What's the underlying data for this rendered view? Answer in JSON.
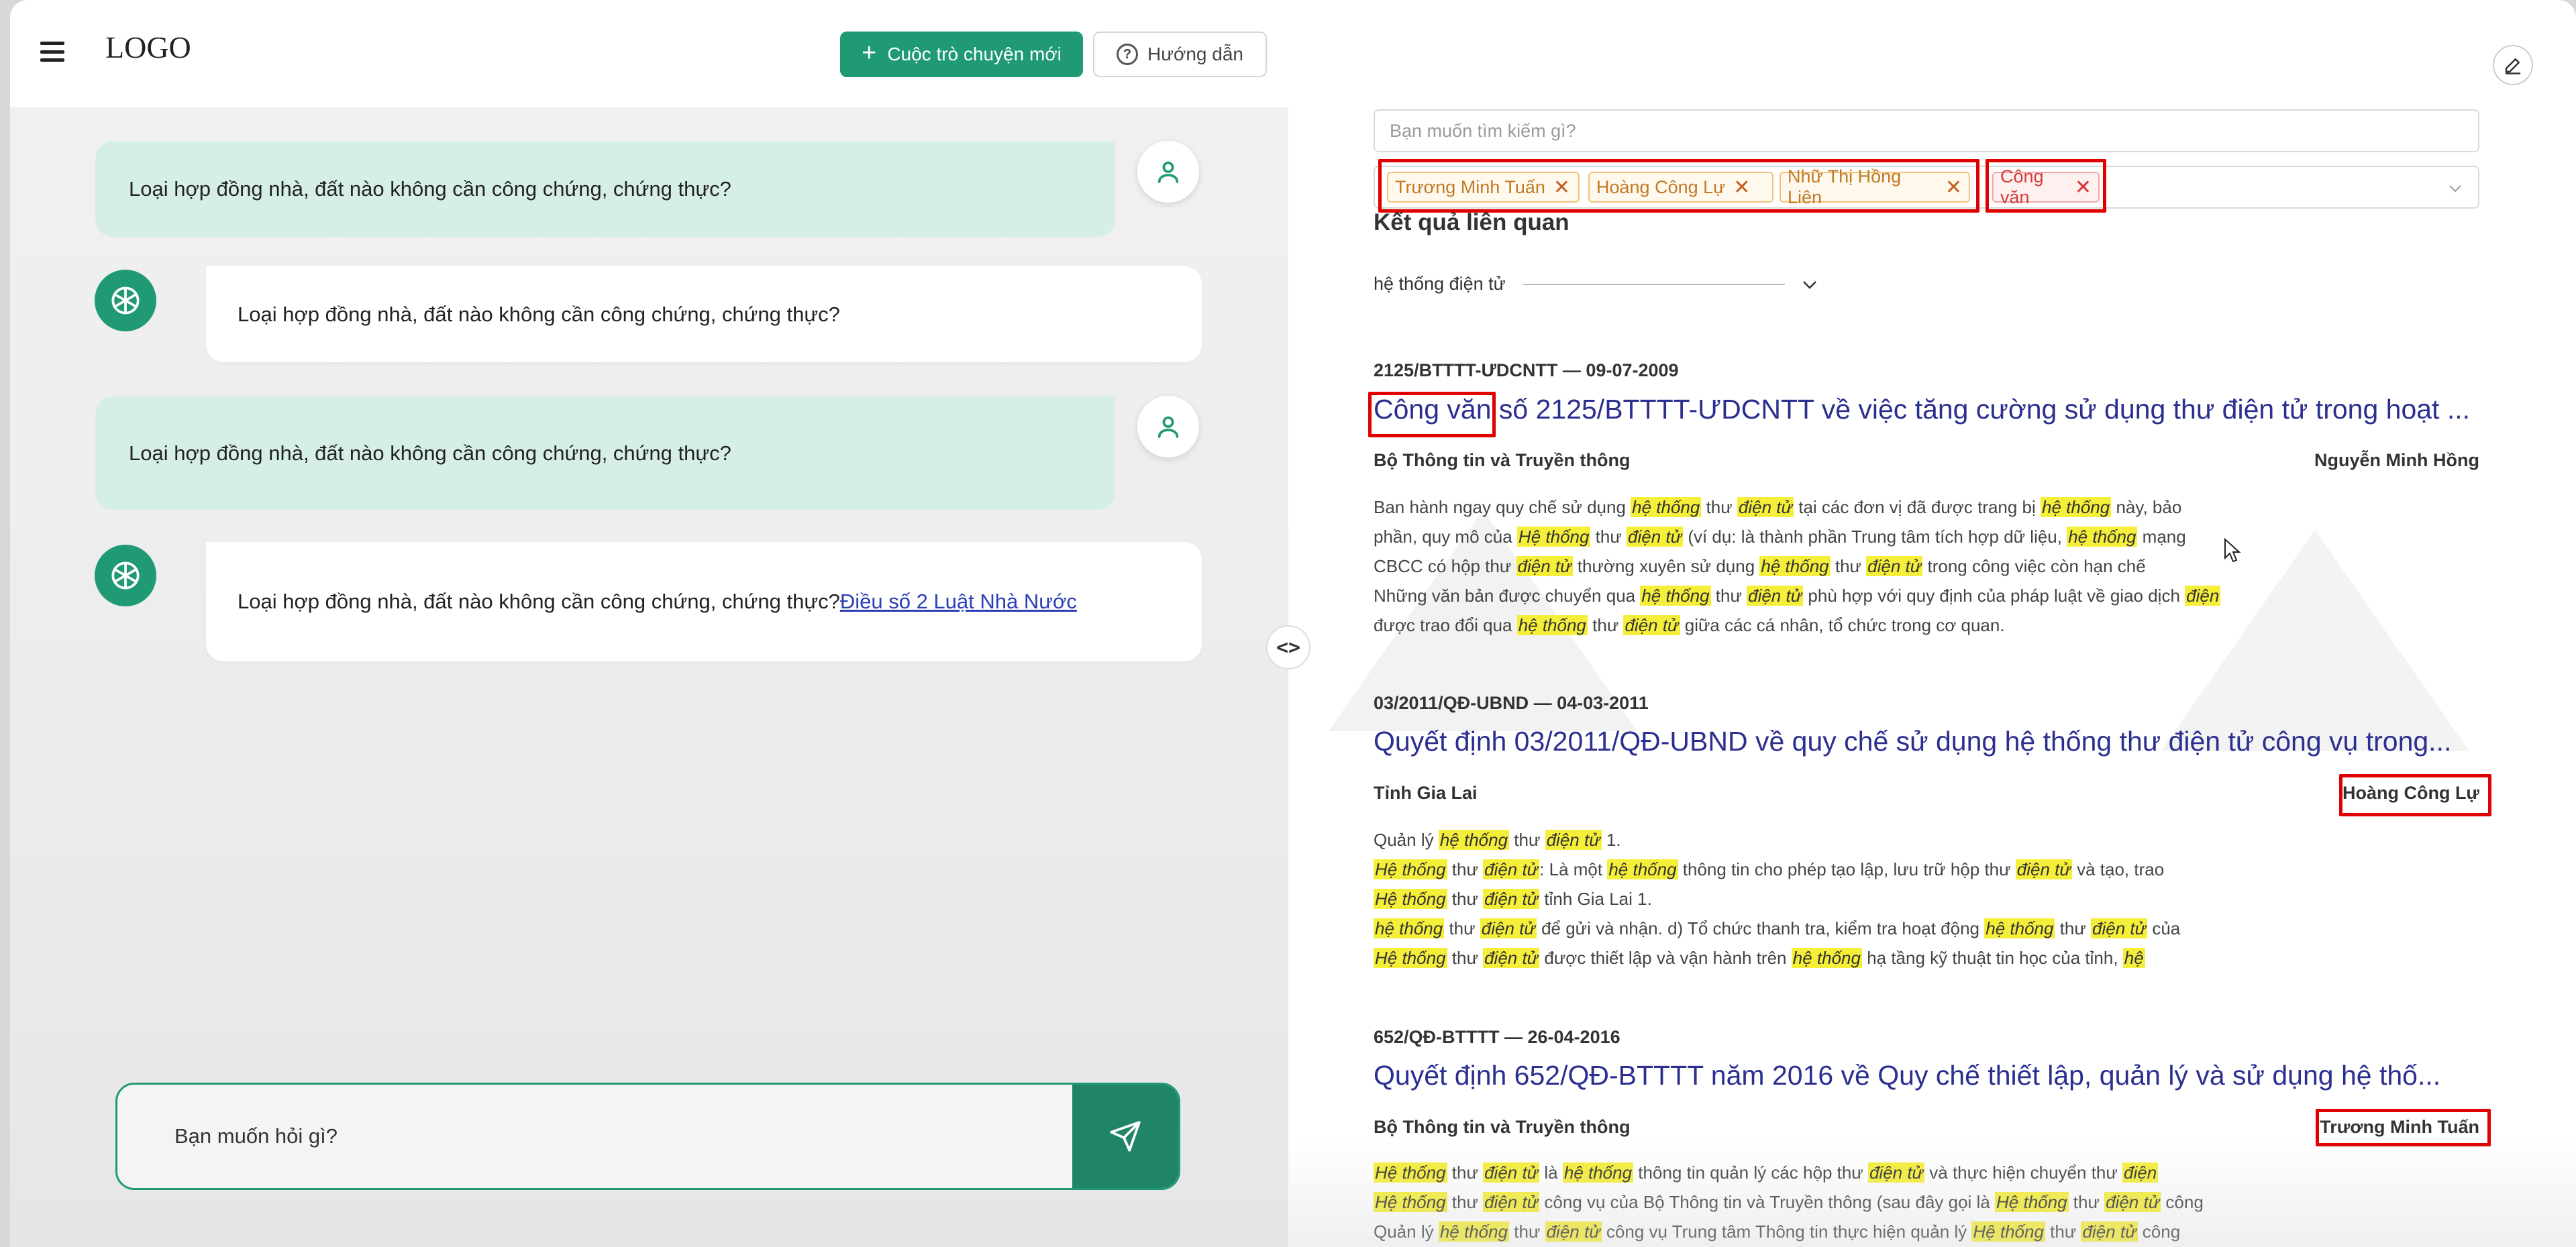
{
  "header": {
    "logo": "LOGO",
    "new_chat_label": "Cuộc trò chuyện mới",
    "guide_label": "Hướng dẫn"
  },
  "messages": [
    {
      "role": "user",
      "text": "Loại hợp đồng nhà, đất nào không cần công chứng, chứng thực?"
    },
    {
      "role": "bot",
      "text": "Loại hợp đồng nhà, đất nào không cần công chứng, chứng thực?"
    },
    {
      "role": "user",
      "text": "Loại hợp đồng nhà, đất nào không cần công chứng, chứng thực?"
    },
    {
      "role": "bot",
      "text": "Loại hợp đồng nhà, đất nào không cần công chứng, chứng thực?",
      "link": "Điều số 2 Luật Nhà Nước"
    }
  ],
  "chat_input": {
    "placeholder": "Bạn muốn hỏi gì?"
  },
  "toggle_label": "<>",
  "search": {
    "placeholder": "Bạn muốn tìm kiếm gì?",
    "tags": [
      "Trương Minh Tuấn",
      "Hoàng Công Lự",
      "Nhữ Thị Hồng Liên"
    ],
    "type_tag": "Công văn"
  },
  "results_title": "Kết quả liên quan",
  "filter_label": "hệ thống điện tử",
  "results": [
    {
      "id": "2125/BTTTT-ƯDCNTT — 09-07-2009",
      "title": "Công văn số 2125/BTTTT-ƯDCNTT về việc tăng cường sử dụng thư điện tử trong hoạt ...",
      "org": "Bộ Thông tin và Truyền thông",
      "person": "Nguyễn Minh Hồng",
      "snippet": [
        "Ban hành ngay quy chế sử dụng [hệ thống] thư [điện tử] tại các đơn vị đã được trang bị [hệ thống] này, bảo",
        "phần, quy mô của [Hệ thống] thư [điện tử] (ví dụ: là thành phần Trung tâm tích hợp dữ liệu, [hệ thống] mạng",
        "CBCC có hộp thư [điện tử] thường xuyên sử dụng [hệ thống] thư [điện tử] trong công việc còn hạn chế",
        "Những văn bản được chuyển qua [hệ thống] thư [điện tử] phù hợp với quy định của pháp luật về giao dịch [điện]",
        "được trao đổi qua [hệ thống] thư [điện tử] giữa các cá nhân, tổ chức trong cơ quan."
      ]
    },
    {
      "id": "03/2011/QĐ-UBND — 04-03-2011",
      "title": "Quyết định 03/2011/QĐ-UBND về quy chế sử dụng hệ thống thư điện tử công vụ trong...",
      "org": "Tỉnh Gia Lai",
      "person": "Hoàng Công Lự",
      "snippet": [
        "Quản lý [hệ thống] thư [điện tử] 1.",
        "[Hệ thống] thư [điện tử]: Là một [hệ thống] thông tin cho phép tạo lập, lưu trữ hộp thư [điện tử] và tạo, trao",
        "[Hệ thống] thư [điện tử] tỉnh Gia Lai 1.",
        "[hệ thống] thư [điện tử] để gửi và nhận. d) Tổ chức thanh tra, kiểm tra hoạt động [hệ thống] thư [điện tử] của",
        "[Hệ thống] thư [điện tử] được thiết lập và vận hành trên [hệ thống] hạ tầng kỹ thuật tin học của tỉnh, [hệ]"
      ]
    },
    {
      "id": "652/QĐ-BTTTT — 26-04-2016",
      "title": "Quyết định 652/QĐ-BTTTT năm 2016 về Quy chế thiết lập, quản lý và sử dụng hệ thố...",
      "org": "Bộ Thông tin và Truyền thông",
      "person": "Trương Minh Tuấn",
      "snippet": [
        "[Hệ thống] thư [điện tử] là [hệ thống] thông tin quản lý các hộp thư [điện tử] và thực hiện chuyển thư [điện]",
        "[Hệ thống] thư [điện tử] công vụ của Bộ Thông tin và Truyền thông (sau đây gọi là [Hệ thống] thư [điện tử] công",
        "Quản lý [hệ thống] thư [điện tử] công vụ Trung tâm Thông tin thực hiện quản lý [Hệ thống] thư [điện tử] công"
      ]
    }
  ],
  "colors": {
    "accent": "#1f9a74",
    "user_bubble": "#d6efe6",
    "title_blue": "#2b2f8f",
    "highlight": "#f6ef3a",
    "annotation_red": "#e00000"
  }
}
